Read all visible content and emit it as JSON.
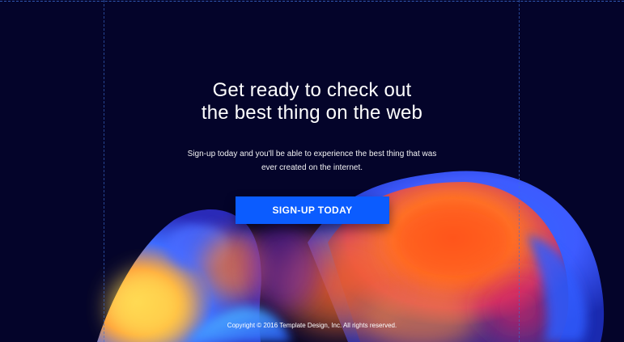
{
  "hero": {
    "headline_line1": "Get ready to check out",
    "headline_line2": "the best thing on the web",
    "subtext_line1": "Sign-up today and you'll be able to experience the best thing that was",
    "subtext_line2": "ever created on the internet.",
    "cta_label": "SIGN-UP TODAY"
  },
  "footer": {
    "copyright": "Copyright © 2016 Template Design, Inc. All rights reserved."
  },
  "colors": {
    "background": "#04042a",
    "cta": "#0b5cff",
    "guide": "#3d6fd6",
    "blob_orange": "#ff6a1a",
    "blob_blue": "#2b57ff",
    "blob_yellow": "#ffd84d",
    "blob_magenta": "#c2185b"
  },
  "icons": {
    "background_art": "gradient-blob-illustration"
  }
}
